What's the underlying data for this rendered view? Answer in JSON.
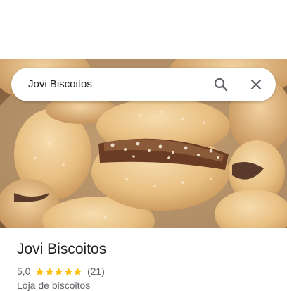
{
  "search": {
    "query": "Jovi Biscoitos",
    "search_icon": "search-icon",
    "close_icon": "close-icon"
  },
  "hero": {
    "photo_subject": "coconut-covered sandwich cookies with dark filling"
  },
  "place": {
    "name": "Jovi Biscoitos",
    "rating": "5,0",
    "stars": 5,
    "review_count": "(21)",
    "category": "Loja de biscoitos"
  },
  "colors": {
    "star": "#fbbc04",
    "text_primary": "#202124",
    "text_secondary": "#5f6368",
    "icon": "#5f6368"
  }
}
